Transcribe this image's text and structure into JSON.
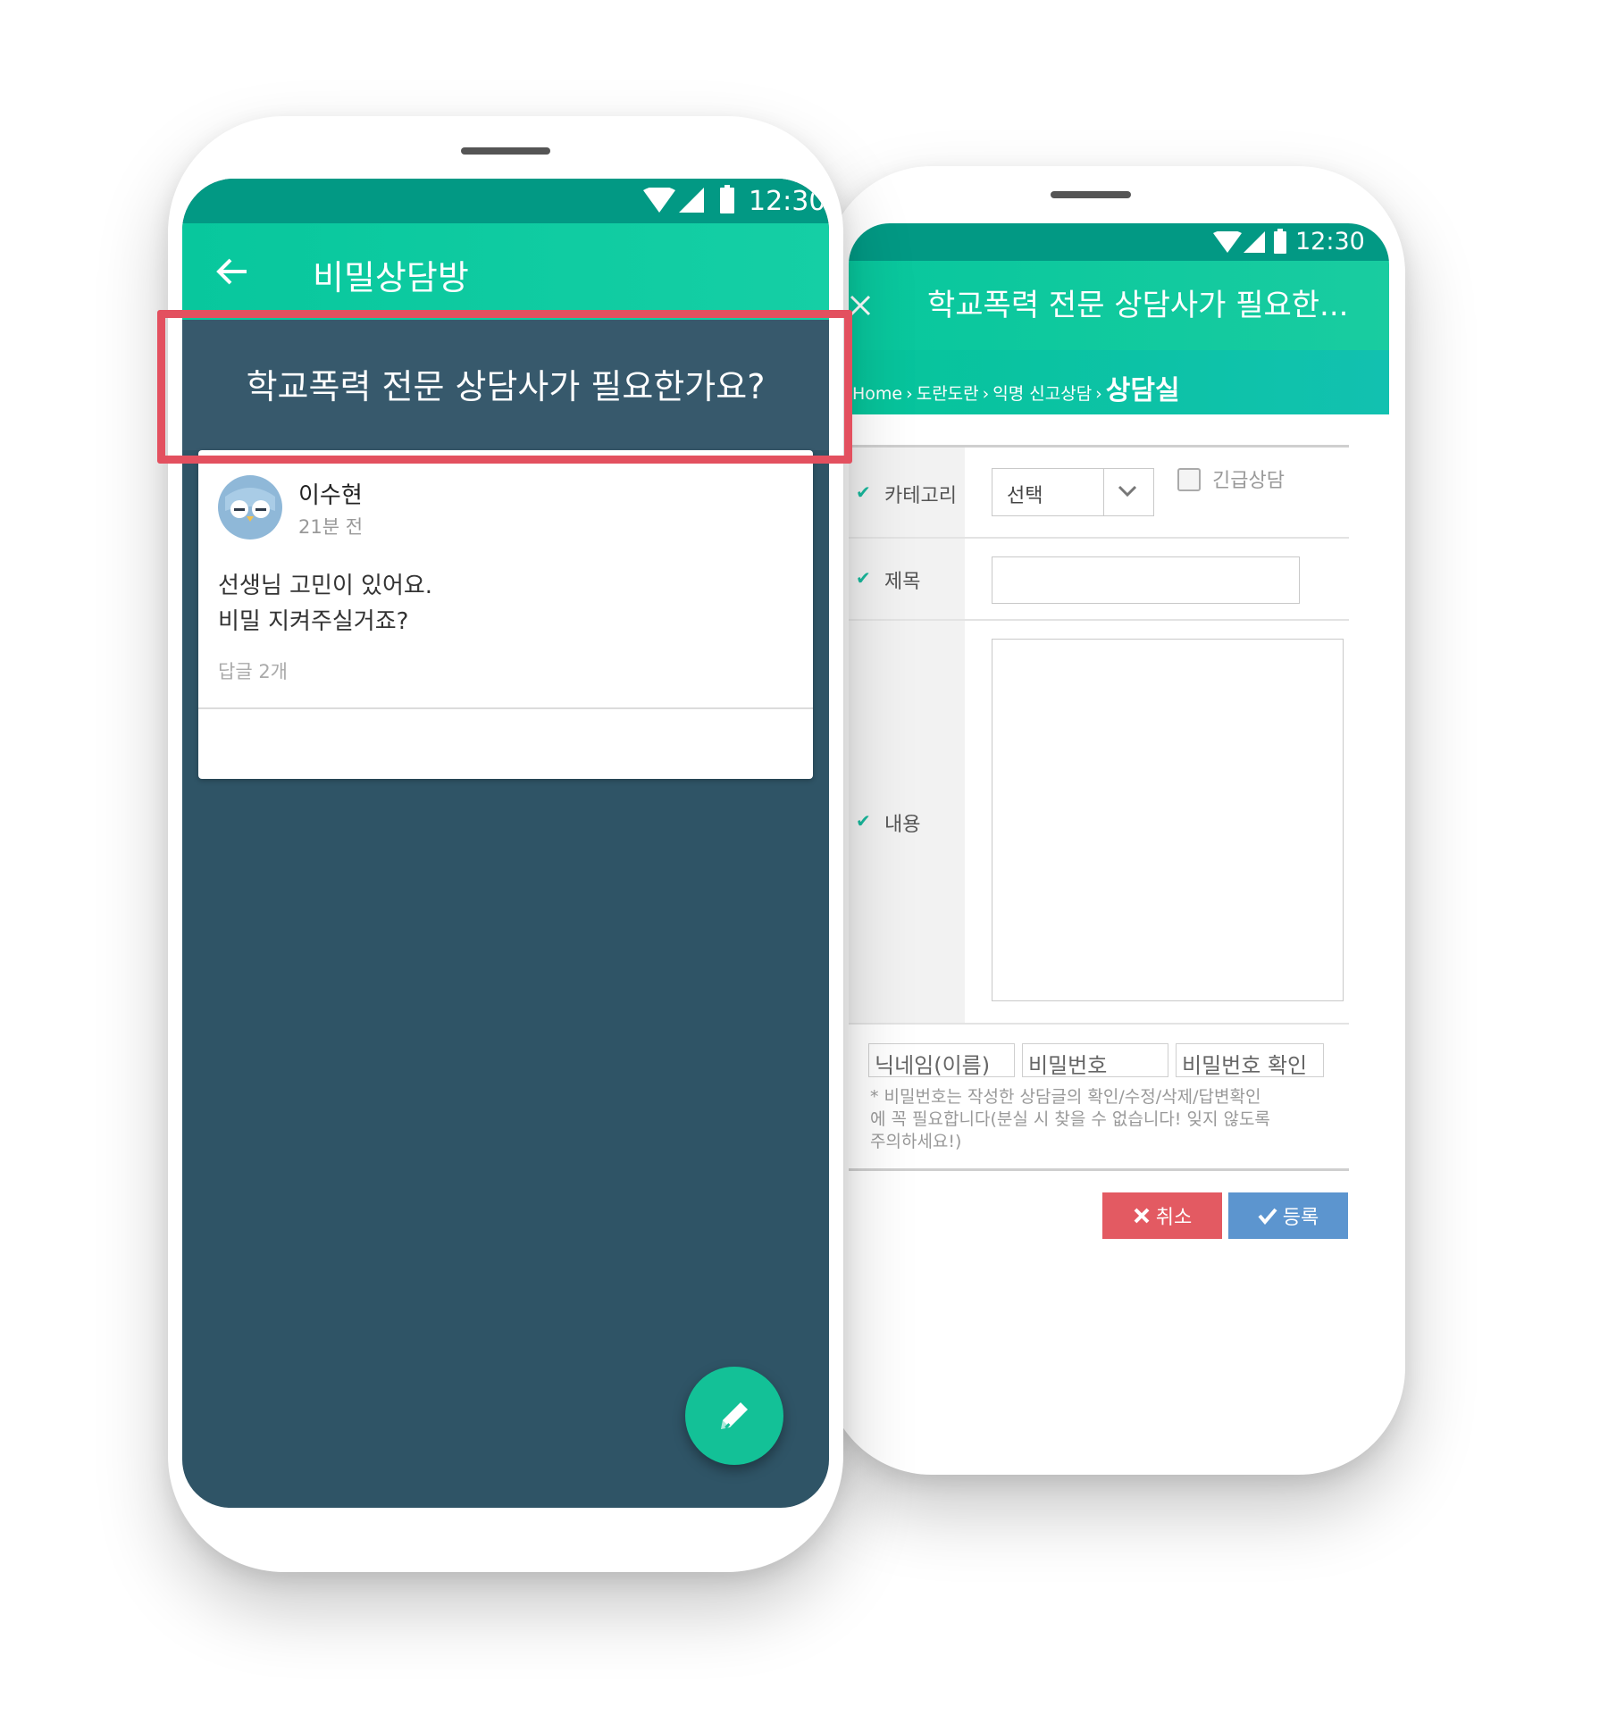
{
  "colors": {
    "status_bar": "#029984",
    "app_bar": "#0ec9a0",
    "front_background": "#2f5466",
    "highlight": "#e3505f",
    "cancel": "#e35a62",
    "submit": "#5c95cf",
    "fab": "#13c197"
  },
  "front": {
    "status": {
      "time": "12:30",
      "icons": [
        "wifi-icon",
        "signal-icon",
        "battery-icon"
      ]
    },
    "appbar": {
      "back_icon": "arrow-left-icon",
      "title": "비밀상담방"
    },
    "question": "학교폭력 전문 상담사가 필요한가요?",
    "post": {
      "author": "이수현",
      "time_ago": "21분 전",
      "body_line1": "선생님 고민이 있어요.",
      "body_line2": "비밀 지켜주실거죠?",
      "reply_count": "답글 2개"
    },
    "fab_icon": "pencil-icon"
  },
  "back": {
    "status": {
      "time": "12:30"
    },
    "appbar": {
      "close_icon": "close-icon",
      "title": "학교폭력 전문 상담사가 필요한..."
    },
    "breadcrumb": {
      "items": [
        "Home",
        "도란도란",
        "익명 신고상담"
      ],
      "current": "상담실"
    },
    "form": {
      "category_label": "카테고리",
      "category_value": "선택",
      "urgent_label": "긴급상담",
      "title_label": "제목",
      "content_label": "내용",
      "nickname_placeholder": "닉네임(이름)",
      "password_placeholder": "비밀번호",
      "password_confirm_placeholder": "비밀번호 확인",
      "notice_line1": "* 비밀번호는 작성한 상담글의 확인/수정/삭제/답변확인",
      "notice_line2": "에 꼭 필요합니다(분실 시 찾을 수 없습니다! 잊지 않도록",
      "notice_line3": "주의하세요!)",
      "cancel_label": "취소",
      "submit_label": "등록"
    }
  }
}
